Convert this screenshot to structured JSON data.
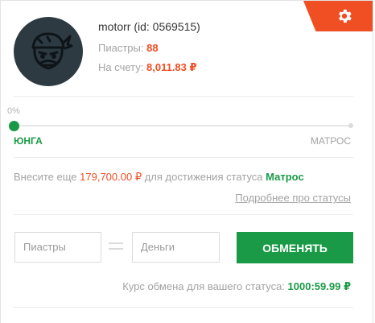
{
  "colors": {
    "accent": "#f04e23",
    "green": "#1a9a46",
    "muted": "#a3a3a3"
  },
  "user": {
    "name_line": "motorr (id: 0569515)",
    "piastres_label": "Пиастры:",
    "piastres_value": "88",
    "balance_label": "На счету:",
    "balance_value": "8,011.83 ₽"
  },
  "progress": {
    "percent_label": "0%",
    "value": 0,
    "current_rank": "ЮНГА",
    "next_rank": "МАТРОС"
  },
  "deposit": {
    "prefix": "Внесите еще",
    "amount": "179,700.00 ₽",
    "middle": "для достижения статуса",
    "status": "Матрос"
  },
  "more_link": "Подробнее про статусы",
  "exchange": {
    "piastres_placeholder": "Пиастры",
    "money_placeholder": "Деньги",
    "button": "ОБМЕНЯТЬ",
    "rate_label": "Курс обмена для вашего статуса:",
    "rate_value": "1000:59.99 ₽"
  },
  "icons": {
    "settings": "gear-icon",
    "avatar": "pirate-avatar-icon"
  }
}
